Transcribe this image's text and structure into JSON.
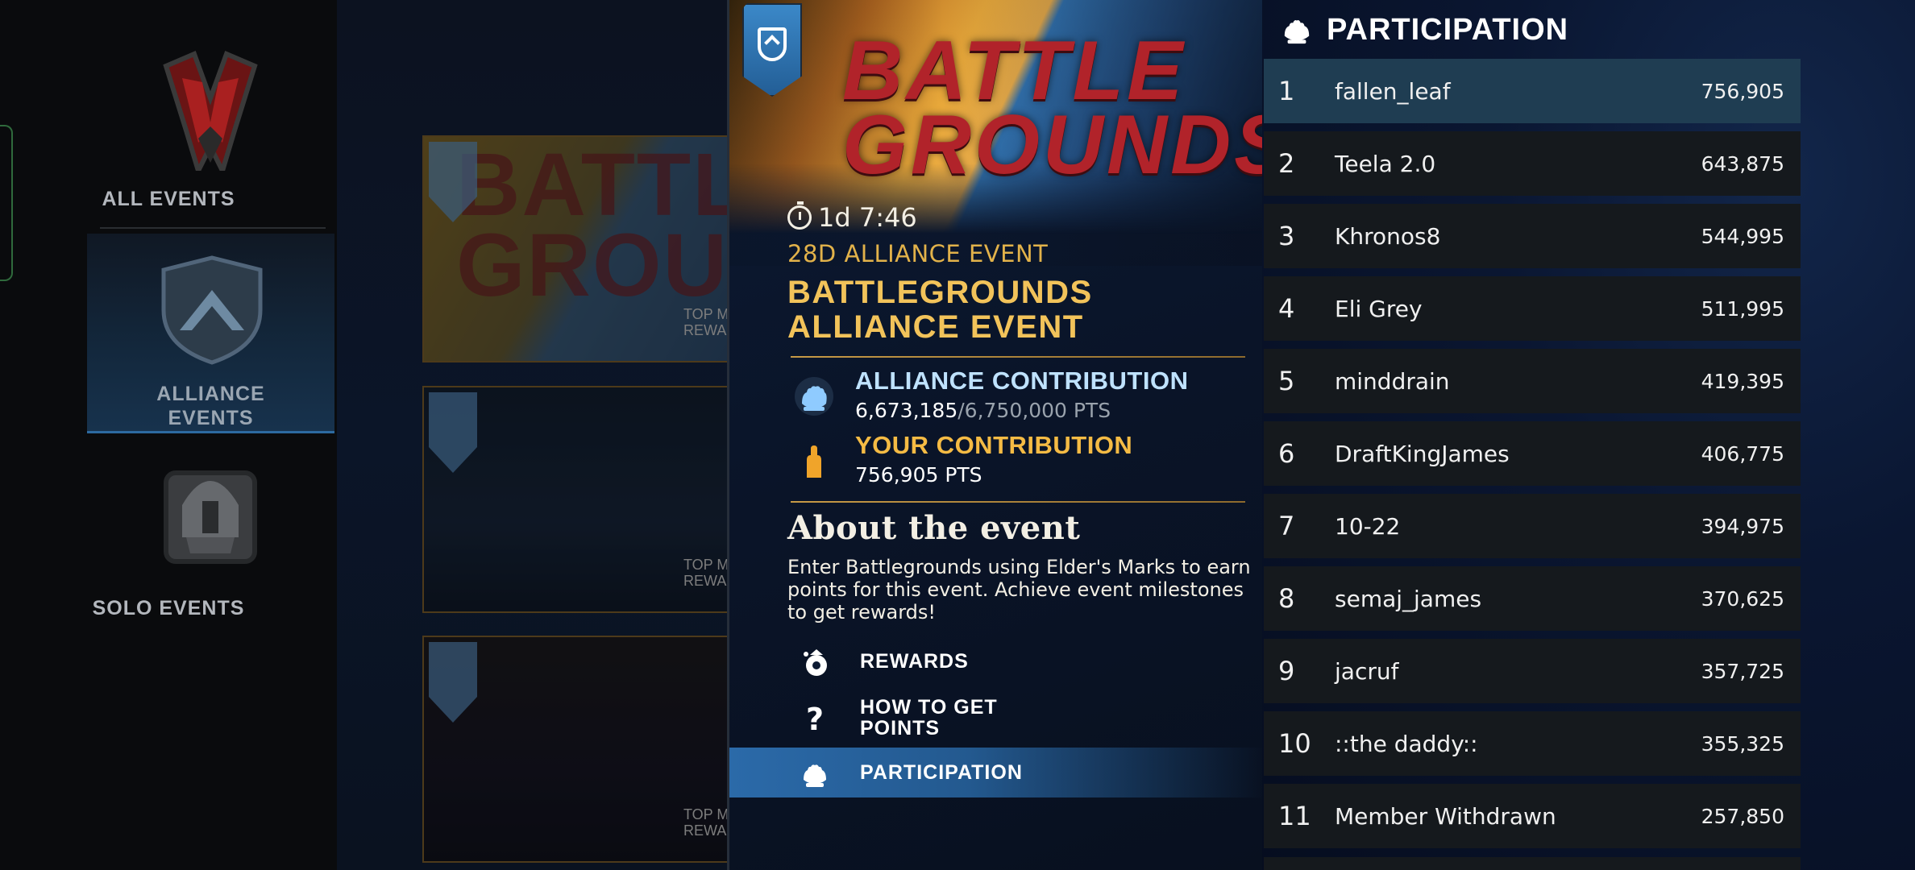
{
  "colors": {
    "gold": "#f2c35a",
    "alliance_blue": "#bfe2ff",
    "your_orange": "#f5bb44",
    "selected_row": "#1f3d52",
    "menu_active": "#2b6aa9"
  },
  "sidebar": {
    "items": [
      {
        "label": "ALL EVENTS",
        "icon": "all-events-crest-icon",
        "selected": false
      },
      {
        "label": "ALLIANCE\nEVENTS",
        "icon": "alliance-shield-icon",
        "selected": true
      },
      {
        "label": "SOLO EVENTS",
        "icon": "solo-helmet-icon",
        "selected": false
      }
    ]
  },
  "event_list": {
    "cards": [
      {
        "logo_text": "BATTLEGROUNDS",
        "reward_label": "TOP M\nREWA"
      },
      {
        "logo_text": "",
        "reward_label": "TOP M\nREWA"
      },
      {
        "logo_text": "",
        "reward_label": "TOP M\nREWA"
      }
    ]
  },
  "detail": {
    "hero_logo_line1": "BATTLE",
    "hero_logo_line2": "GROUNDS",
    "timer": "1d 7:46",
    "tag": "28D ALLIANCE EVENT",
    "title": "BATTLEGROUNDS ALLIANCE EVENT",
    "alliance_contribution": {
      "label": "ALLIANCE CONTRIBUTION",
      "current": "6,673,185",
      "target": "6,750,000 PTS",
      "progress_fraction": 0.9886
    },
    "your_contribution": {
      "label": "YOUR CONTRIBUTION",
      "value": "756,905 PTS"
    },
    "about_title": "About the event",
    "about_body": "Enter Battlegrounds using Elder's Marks to earn points for this event. Achieve event milestones to get rewards!",
    "menu": {
      "rewards": "REWARDS",
      "how_to_get_points": "HOW TO GET POINTS",
      "participation": "PARTICIPATION"
    }
  },
  "participation": {
    "title": "PARTICIPATION",
    "rows": [
      {
        "rank": "1",
        "name": "fallen_leaf",
        "points": "756,905",
        "selected": true
      },
      {
        "rank": "2",
        "name": "Teela 2.0",
        "points": "643,875"
      },
      {
        "rank": "3",
        "name": "Khronos8",
        "points": "544,995"
      },
      {
        "rank": "4",
        "name": "Eli Grey",
        "points": "511,995"
      },
      {
        "rank": "5",
        "name": "minddrain",
        "points": "419,395"
      },
      {
        "rank": "6",
        "name": "DraftKingJames",
        "points": "406,775"
      },
      {
        "rank": "7",
        "name": "10-22",
        "points": "394,975"
      },
      {
        "rank": "8",
        "name": "semaj_james",
        "points": "370,625"
      },
      {
        "rank": "9",
        "name": "jacruf",
        "points": "357,725"
      },
      {
        "rank": "10",
        "name": "::the daddy::",
        "points": "355,325"
      },
      {
        "rank": "11",
        "name": "Member Withdrawn",
        "points": "257,850"
      }
    ]
  }
}
